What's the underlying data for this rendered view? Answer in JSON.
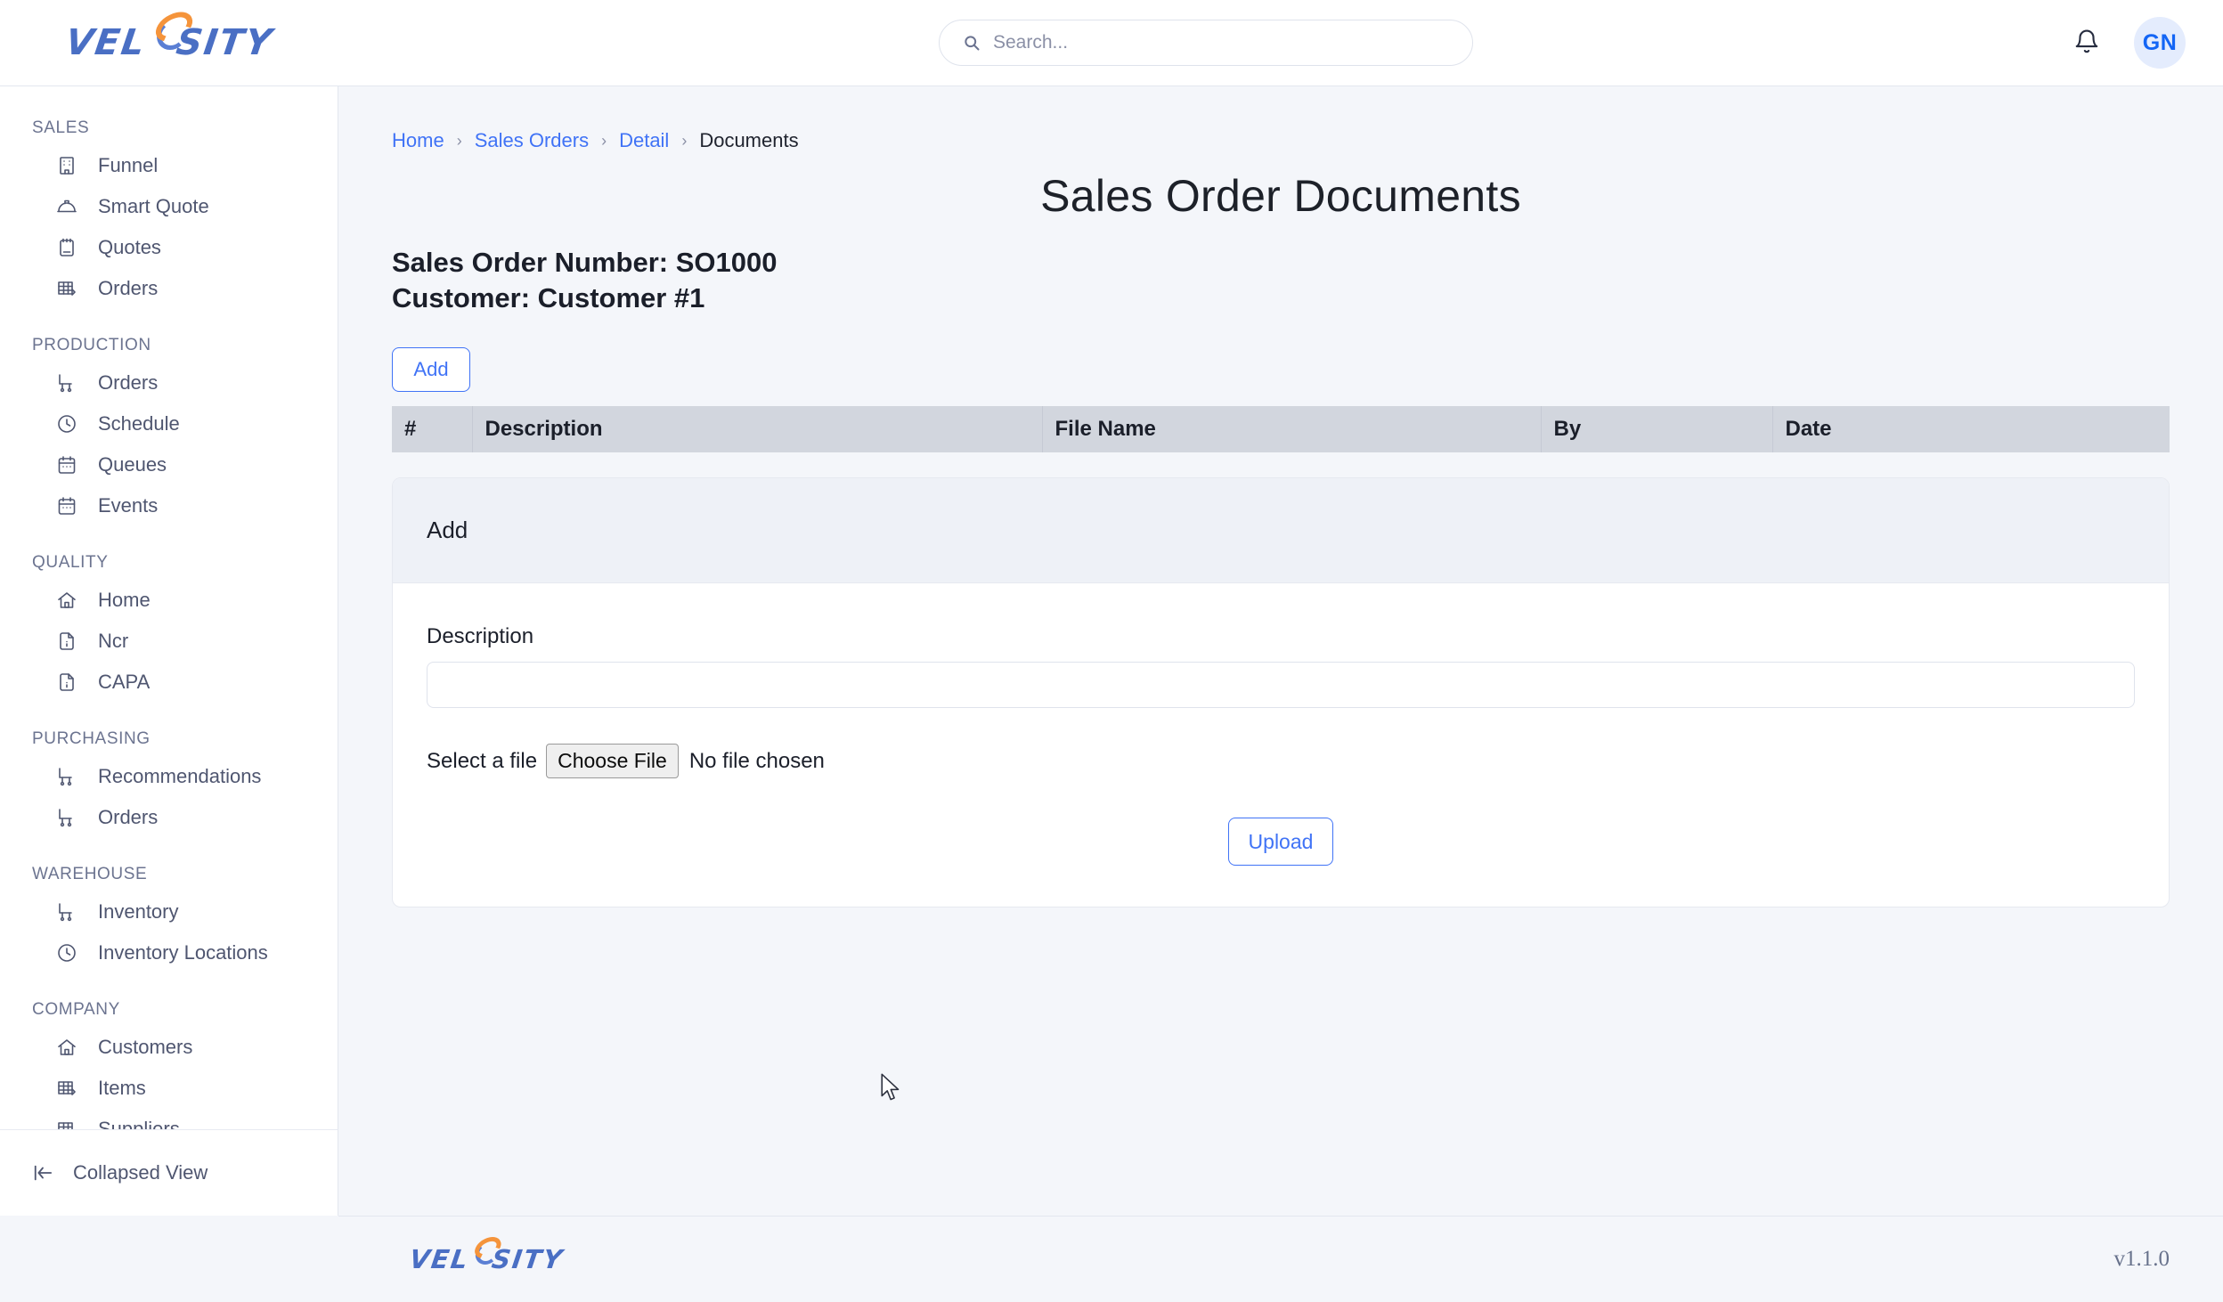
{
  "brand": {
    "name_part1": "VEL",
    "name_part2": "SITY",
    "full": "VELOSITY"
  },
  "topbar": {
    "search_placeholder": "Search...",
    "search_value": "",
    "avatar_initials": "GN"
  },
  "sidebar": {
    "sections": [
      {
        "title": "SALES",
        "items": [
          {
            "label": "Funnel",
            "icon": "building-icon"
          },
          {
            "label": "Smart Quote",
            "icon": "hardhat-icon"
          },
          {
            "label": "Quotes",
            "icon": "clipboard-icon"
          },
          {
            "label": "Orders",
            "icon": "table-grid-icon"
          }
        ]
      },
      {
        "title": "PRODUCTION",
        "items": [
          {
            "label": "Orders",
            "icon": "cart-icon"
          },
          {
            "label": "Schedule",
            "icon": "clock-icon"
          },
          {
            "label": "Queues",
            "icon": "calendar-icon"
          },
          {
            "label": "Events",
            "icon": "calendar-icon"
          }
        ]
      },
      {
        "title": "QUALITY",
        "items": [
          {
            "label": "Home",
            "icon": "home-icon"
          },
          {
            "label": "Ncr",
            "icon": "file-info-icon"
          },
          {
            "label": "CAPA",
            "icon": "file-info-icon"
          }
        ]
      },
      {
        "title": "PURCHASING",
        "items": [
          {
            "label": "Recommendations",
            "icon": "cart-icon"
          },
          {
            "label": "Orders",
            "icon": "cart-icon"
          }
        ]
      },
      {
        "title": "WAREHOUSE",
        "items": [
          {
            "label": "Inventory",
            "icon": "cart-icon"
          },
          {
            "label": "Inventory Locations",
            "icon": "clock-icon"
          }
        ]
      },
      {
        "title": "COMPANY",
        "items": [
          {
            "label": "Customers",
            "icon": "home-icon"
          },
          {
            "label": "Items",
            "icon": "table-grid-icon"
          },
          {
            "label": "Suppliers",
            "icon": "table-grid-icon"
          }
        ]
      }
    ],
    "collapse_label": "Collapsed View"
  },
  "breadcrumb": {
    "items": [
      {
        "label": "Home",
        "link": true
      },
      {
        "label": "Sales Orders",
        "link": true
      },
      {
        "label": "Detail",
        "link": true
      },
      {
        "label": "Documents",
        "link": false
      }
    ],
    "separator": "›"
  },
  "page": {
    "title": "Sales Order Documents",
    "order_line": "Sales Order Number: SO1000",
    "customer_line": "Customer: Customer #1",
    "add_button": "Add"
  },
  "table": {
    "columns": [
      "#",
      "Description",
      "File Name",
      "By",
      "Date"
    ],
    "rows": []
  },
  "add_panel": {
    "header": "Add",
    "description_label": "Description",
    "description_value": "",
    "select_file_label": "Select a file",
    "choose_file_button": "Choose File",
    "no_file_text": "No file chosen",
    "upload_button": "Upload"
  },
  "footer": {
    "version": "v1.1.0"
  },
  "colors": {
    "accent_blue": "#4073f6",
    "brand_blue": "#4a6fc4",
    "brand_orange": "#f5943b",
    "page_bg": "#f4f6fa",
    "table_header_bg": "#d2d6de",
    "card_header_bg": "#eef1f7"
  }
}
